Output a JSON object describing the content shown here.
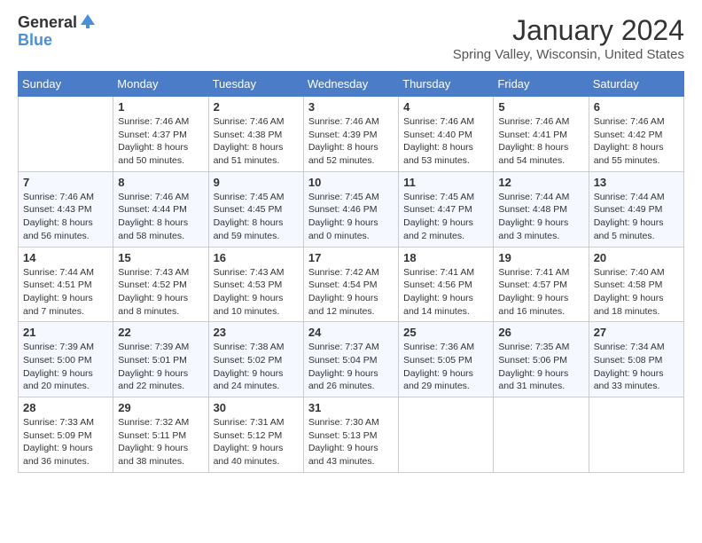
{
  "logo": {
    "general": "General",
    "blue": "Blue"
  },
  "title": "January 2024",
  "subtitle": "Spring Valley, Wisconsin, United States",
  "weekdays": [
    "Sunday",
    "Monday",
    "Tuesday",
    "Wednesday",
    "Thursday",
    "Friday",
    "Saturday"
  ],
  "weeks": [
    [
      {
        "day": "",
        "sunrise": "",
        "sunset": "",
        "daylight": ""
      },
      {
        "day": "1",
        "sunrise": "Sunrise: 7:46 AM",
        "sunset": "Sunset: 4:37 PM",
        "daylight": "Daylight: 8 hours and 50 minutes."
      },
      {
        "day": "2",
        "sunrise": "Sunrise: 7:46 AM",
        "sunset": "Sunset: 4:38 PM",
        "daylight": "Daylight: 8 hours and 51 minutes."
      },
      {
        "day": "3",
        "sunrise": "Sunrise: 7:46 AM",
        "sunset": "Sunset: 4:39 PM",
        "daylight": "Daylight: 8 hours and 52 minutes."
      },
      {
        "day": "4",
        "sunrise": "Sunrise: 7:46 AM",
        "sunset": "Sunset: 4:40 PM",
        "daylight": "Daylight: 8 hours and 53 minutes."
      },
      {
        "day": "5",
        "sunrise": "Sunrise: 7:46 AM",
        "sunset": "Sunset: 4:41 PM",
        "daylight": "Daylight: 8 hours and 54 minutes."
      },
      {
        "day": "6",
        "sunrise": "Sunrise: 7:46 AM",
        "sunset": "Sunset: 4:42 PM",
        "daylight": "Daylight: 8 hours and 55 minutes."
      }
    ],
    [
      {
        "day": "7",
        "sunrise": "Sunrise: 7:46 AM",
        "sunset": "Sunset: 4:43 PM",
        "daylight": "Daylight: 8 hours and 56 minutes."
      },
      {
        "day": "8",
        "sunrise": "Sunrise: 7:46 AM",
        "sunset": "Sunset: 4:44 PM",
        "daylight": "Daylight: 8 hours and 58 minutes."
      },
      {
        "day": "9",
        "sunrise": "Sunrise: 7:45 AM",
        "sunset": "Sunset: 4:45 PM",
        "daylight": "Daylight: 8 hours and 59 minutes."
      },
      {
        "day": "10",
        "sunrise": "Sunrise: 7:45 AM",
        "sunset": "Sunset: 4:46 PM",
        "daylight": "Daylight: 9 hours and 0 minutes."
      },
      {
        "day": "11",
        "sunrise": "Sunrise: 7:45 AM",
        "sunset": "Sunset: 4:47 PM",
        "daylight": "Daylight: 9 hours and 2 minutes."
      },
      {
        "day": "12",
        "sunrise": "Sunrise: 7:44 AM",
        "sunset": "Sunset: 4:48 PM",
        "daylight": "Daylight: 9 hours and 3 minutes."
      },
      {
        "day": "13",
        "sunrise": "Sunrise: 7:44 AM",
        "sunset": "Sunset: 4:49 PM",
        "daylight": "Daylight: 9 hours and 5 minutes."
      }
    ],
    [
      {
        "day": "14",
        "sunrise": "Sunrise: 7:44 AM",
        "sunset": "Sunset: 4:51 PM",
        "daylight": "Daylight: 9 hours and 7 minutes."
      },
      {
        "day": "15",
        "sunrise": "Sunrise: 7:43 AM",
        "sunset": "Sunset: 4:52 PM",
        "daylight": "Daylight: 9 hours and 8 minutes."
      },
      {
        "day": "16",
        "sunrise": "Sunrise: 7:43 AM",
        "sunset": "Sunset: 4:53 PM",
        "daylight": "Daylight: 9 hours and 10 minutes."
      },
      {
        "day": "17",
        "sunrise": "Sunrise: 7:42 AM",
        "sunset": "Sunset: 4:54 PM",
        "daylight": "Daylight: 9 hours and 12 minutes."
      },
      {
        "day": "18",
        "sunrise": "Sunrise: 7:41 AM",
        "sunset": "Sunset: 4:56 PM",
        "daylight": "Daylight: 9 hours and 14 minutes."
      },
      {
        "day": "19",
        "sunrise": "Sunrise: 7:41 AM",
        "sunset": "Sunset: 4:57 PM",
        "daylight": "Daylight: 9 hours and 16 minutes."
      },
      {
        "day": "20",
        "sunrise": "Sunrise: 7:40 AM",
        "sunset": "Sunset: 4:58 PM",
        "daylight": "Daylight: 9 hours and 18 minutes."
      }
    ],
    [
      {
        "day": "21",
        "sunrise": "Sunrise: 7:39 AM",
        "sunset": "Sunset: 5:00 PM",
        "daylight": "Daylight: 9 hours and 20 minutes."
      },
      {
        "day": "22",
        "sunrise": "Sunrise: 7:39 AM",
        "sunset": "Sunset: 5:01 PM",
        "daylight": "Daylight: 9 hours and 22 minutes."
      },
      {
        "day": "23",
        "sunrise": "Sunrise: 7:38 AM",
        "sunset": "Sunset: 5:02 PM",
        "daylight": "Daylight: 9 hours and 24 minutes."
      },
      {
        "day": "24",
        "sunrise": "Sunrise: 7:37 AM",
        "sunset": "Sunset: 5:04 PM",
        "daylight": "Daylight: 9 hours and 26 minutes."
      },
      {
        "day": "25",
        "sunrise": "Sunrise: 7:36 AM",
        "sunset": "Sunset: 5:05 PM",
        "daylight": "Daylight: 9 hours and 29 minutes."
      },
      {
        "day": "26",
        "sunrise": "Sunrise: 7:35 AM",
        "sunset": "Sunset: 5:06 PM",
        "daylight": "Daylight: 9 hours and 31 minutes."
      },
      {
        "day": "27",
        "sunrise": "Sunrise: 7:34 AM",
        "sunset": "Sunset: 5:08 PM",
        "daylight": "Daylight: 9 hours and 33 minutes."
      }
    ],
    [
      {
        "day": "28",
        "sunrise": "Sunrise: 7:33 AM",
        "sunset": "Sunset: 5:09 PM",
        "daylight": "Daylight: 9 hours and 36 minutes."
      },
      {
        "day": "29",
        "sunrise": "Sunrise: 7:32 AM",
        "sunset": "Sunset: 5:11 PM",
        "daylight": "Daylight: 9 hours and 38 minutes."
      },
      {
        "day": "30",
        "sunrise": "Sunrise: 7:31 AM",
        "sunset": "Sunset: 5:12 PM",
        "daylight": "Daylight: 9 hours and 40 minutes."
      },
      {
        "day": "31",
        "sunrise": "Sunrise: 7:30 AM",
        "sunset": "Sunset: 5:13 PM",
        "daylight": "Daylight: 9 hours and 43 minutes."
      },
      {
        "day": "",
        "sunrise": "",
        "sunset": "",
        "daylight": ""
      },
      {
        "day": "",
        "sunrise": "",
        "sunset": "",
        "daylight": ""
      },
      {
        "day": "",
        "sunrise": "",
        "sunset": "",
        "daylight": ""
      }
    ]
  ]
}
